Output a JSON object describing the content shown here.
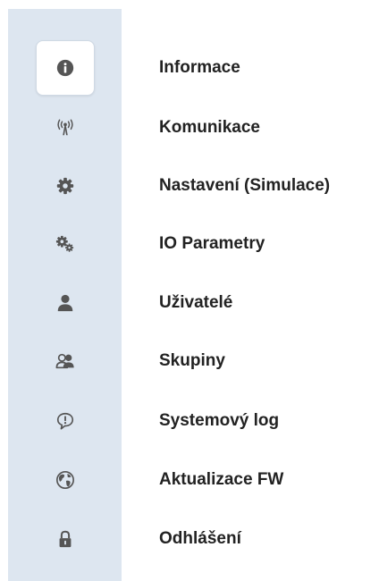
{
  "menu": {
    "items": [
      {
        "label": "Informace",
        "icon": "info-icon",
        "active": true
      },
      {
        "label": "Komunikace",
        "icon": "antenna-icon",
        "active": false
      },
      {
        "label": "Nastavení (Simulace)",
        "icon": "gear-icon",
        "active": false
      },
      {
        "label": "IO Parametry",
        "icon": "gears-icon",
        "active": false
      },
      {
        "label": "Uživatelé",
        "icon": "user-icon",
        "active": false
      },
      {
        "label": "Skupiny",
        "icon": "users-group-icon",
        "active": false
      },
      {
        "label": "Systemový log",
        "icon": "speech-bubble-exclamation-icon",
        "active": false
      },
      {
        "label": "Aktualizace FW",
        "icon": "globe-icon",
        "active": false
      },
      {
        "label": "Odhlášení",
        "icon": "lock-icon",
        "active": false
      }
    ]
  },
  "colors": {
    "sidebar_bg": "#dde6f0",
    "icon": "#555555",
    "label_text": "#222222"
  }
}
